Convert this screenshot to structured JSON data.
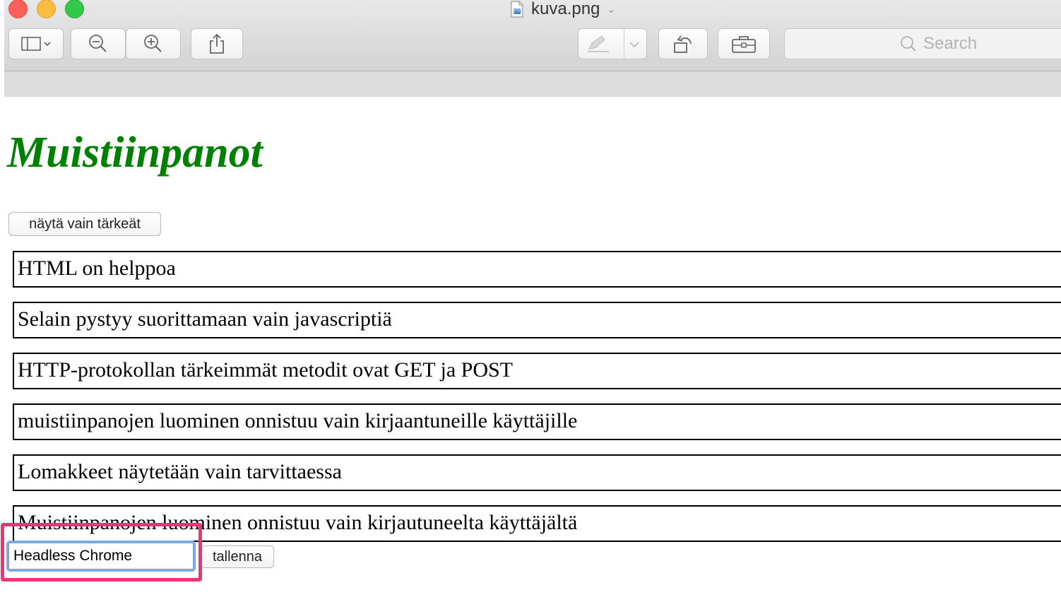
{
  "window": {
    "title": "kuva.png",
    "title_icon": "image-file-icon",
    "title_chevron": "⌄"
  },
  "toolbar": {
    "sidebar_button": "sidebar-toggle-icon",
    "zoom_out": "zoom-out-icon",
    "zoom_in": "zoom-in-icon",
    "share": "share-icon",
    "markup": "pen-markup-icon",
    "rotate": "rotate-icon",
    "toolbox": "toolbox-icon",
    "search_placeholder": "Search"
  },
  "page": {
    "heading": "Muistiinpanot",
    "heading_color": "#008000",
    "filter_button": "näytä vain tärkeät",
    "notes": [
      "HTML on helppoa",
      "Selain pystyy suorittamaan vain javascriptiä",
      "HTTP-protokollan tärkeimmät metodit ovat GET ja POST",
      "muistiinpanojen luominen onnistuu vain kirjaantuneille käyttäjille",
      "Lomakkeet näytetään vain tarvittaessa",
      "Muistiinpanojen luominen onnistuu vain kirjautuneelta käyttäjältä"
    ],
    "form": {
      "input_value": "Headless Chrome",
      "save_button": "tallenna"
    }
  },
  "annotation": {
    "highlight_color": "#f0327a"
  }
}
